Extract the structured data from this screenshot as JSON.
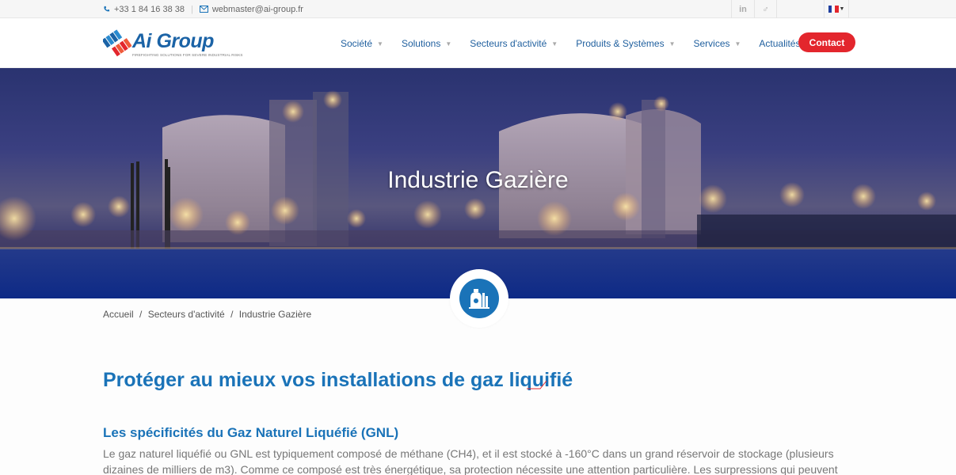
{
  "topbar": {
    "phone": "+33 1 84 16 38 38",
    "email": "webmaster@ai-group.fr",
    "social": [
      {
        "icon": "linkedin-icon",
        "label": "in"
      },
      {
        "icon": "viadeo-icon",
        "label": "♂"
      }
    ],
    "language": {
      "icon": "france-flag-icon",
      "colors": [
        "#1f3f9f",
        "#ffffff",
        "#e3262d"
      ]
    }
  },
  "header": {
    "logo": {
      "name": "Ai Group",
      "tagline": "FIREFIGHTING SOLUTIONS FOR SEVERE INDUSTRIAL RISKS"
    },
    "nav": [
      {
        "label": "Société",
        "dropdown": true
      },
      {
        "label": "Solutions",
        "dropdown": true
      },
      {
        "label": "Secteurs d'activité",
        "dropdown": true
      },
      {
        "label": "Produits & Systèmes",
        "dropdown": true
      },
      {
        "label": "Services",
        "dropdown": true
      },
      {
        "label": "Actualités",
        "dropdown": false
      }
    ],
    "contact_label": "Contact"
  },
  "hero": {
    "title": "Industrie Gazière",
    "badge_icon": "gas-industry-icon"
  },
  "breadcrumb": {
    "items": [
      "Accueil",
      "Secteurs d'activité",
      "Industrie Gazière"
    ],
    "separator": "/"
  },
  "content": {
    "heading": "Protéger au mieux vos installations de gaz liquifié",
    "subheading": "Les spécificités du Gaz Naturel Liquéfié (GNL)",
    "paragraph": "Le gaz naturel liquéfié ou GNL est typiquement composé de méthane (CH4), et il est stocké à -160°C dans un grand réservoir de stockage (plusieurs dizaines de milliers de m3). Comme ce composé est très énergétique, sa protection nécessite une attention particulière. Les surpressions qui peuvent"
  },
  "colors": {
    "brand_blue": "#1a73b8",
    "nav_blue": "#1f5f9e",
    "contact_red": "#e3262d"
  }
}
